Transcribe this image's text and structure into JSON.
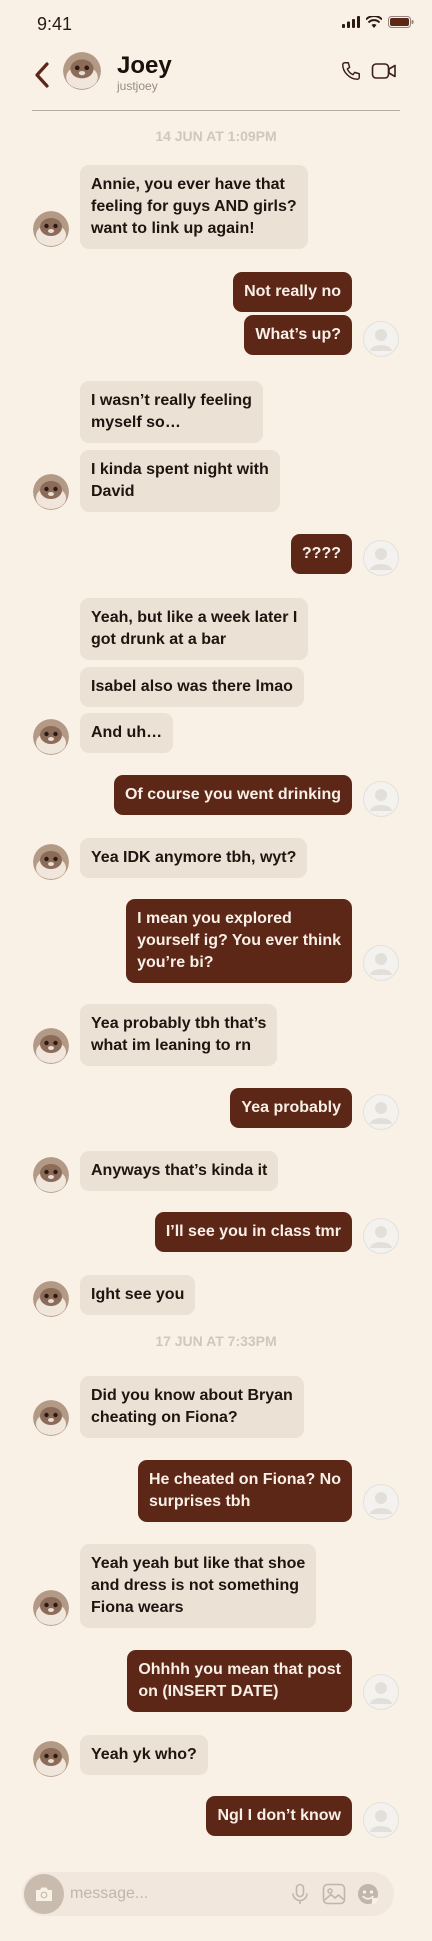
{
  "status": {
    "time": "9:41"
  },
  "header": {
    "name": "Joey",
    "handle": "justjoey"
  },
  "timestamps": [
    "14 JUN AT 1:09PM",
    "17 JUN AT 7:33PM"
  ],
  "messages": [
    {
      "from": "in",
      "text": "Annie, you ever have that\nfeeling for guys AND girls?\nwant to link up again!"
    },
    {
      "from": "out",
      "text": "Not really no"
    },
    {
      "from": "out",
      "text": "What’s up?"
    },
    {
      "from": "in",
      "text": "I wasn’t really feeling\nmyself so…"
    },
    {
      "from": "in",
      "text": "I kinda spent night with\nDavid"
    },
    {
      "from": "out",
      "text": "????"
    },
    {
      "from": "in",
      "text": "Yeah, but like a week later I\ngot drunk at a bar"
    },
    {
      "from": "in",
      "text": "Isabel also was there lmao"
    },
    {
      "from": "in",
      "text": "And uh…"
    },
    {
      "from": "out",
      "text": "Of course you went drinking"
    },
    {
      "from": "in",
      "text": "Yea IDK anymore tbh, wyt?"
    },
    {
      "from": "out",
      "text": "I mean you explored\nyourself ig? You ever think\nyou’re bi?"
    },
    {
      "from": "in",
      "text": "Yea probably tbh that’s\nwhat im leaning to rn"
    },
    {
      "from": "out",
      "text": "Yea probably"
    },
    {
      "from": "in",
      "text": "Anyways that’s kinda it"
    },
    {
      "from": "out",
      "text": "I’ll see you in class tmr"
    },
    {
      "from": "in",
      "text": "Ight see you"
    },
    {
      "from": "in",
      "text": "Did you know about Bryan\ncheating on Fiona?"
    },
    {
      "from": "out",
      "text": "He cheated on Fiona? No\nsurprises tbh"
    },
    {
      "from": "in",
      "text": "Yeah yeah but like that shoe\nand dress is not something\nFiona wears"
    },
    {
      "from": "out",
      "text": "Ohhhh you mean that post\non (INSERT DATE)"
    },
    {
      "from": "in",
      "text": "Yeah yk who?"
    },
    {
      "from": "out",
      "text": "Ngl I don’t know"
    }
  ],
  "composer": {
    "placeholder": "message...",
    "value": ""
  },
  "icons": {
    "back": "chevron-left-icon",
    "call": "phone-icon",
    "video": "video-camera-icon",
    "camera": "camera-icon",
    "mic": "microphone-icon",
    "gallery": "image-icon",
    "sticker": "sticker-icon"
  },
  "colors": {
    "background": "#faf1e6",
    "incoming_bubble": "#ebe1d5",
    "outgoing_bubble": "#5c2717",
    "accent": "#5c2717"
  }
}
